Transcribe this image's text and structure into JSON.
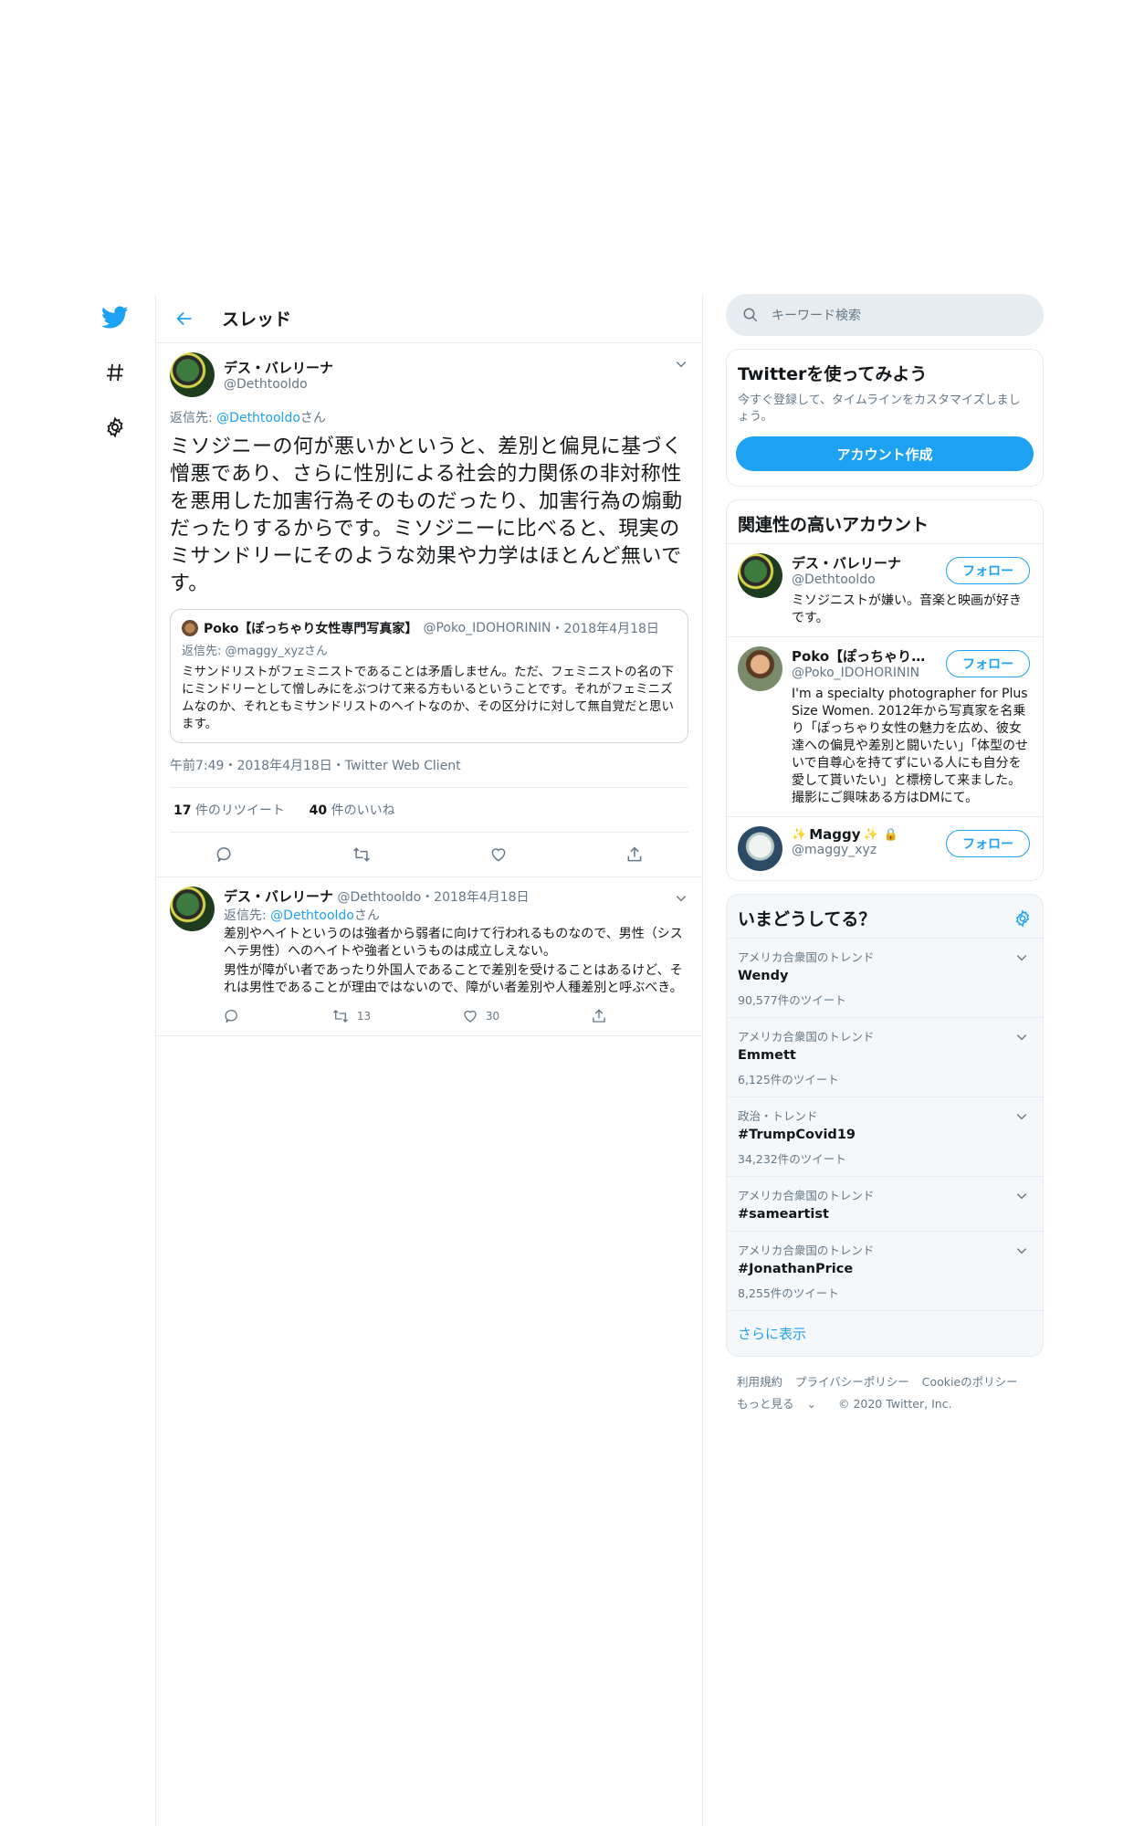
{
  "nav": {
    "icons": [
      "twitter-bird-icon",
      "hashtag-icon",
      "gear-icon"
    ]
  },
  "header": {
    "title": "スレッド"
  },
  "main_tweet": {
    "name": "デス・バレリーナ",
    "handle": "@Dethtooldo",
    "reply_prefix": "返信先: ",
    "reply_to": "@Dethtooldo",
    "reply_suffix": "さん",
    "text": "ミソジニーの何が悪いかというと、差別と偏見に基づく憎悪であり、さらに性別による社会的力関係の非対称性を悪用した加害行為そのものだったり、加害行為の煽動だったりするからです。ミソジニーに比べると、現実のミサンドリーにそのような効果や力学はほとんど無いです。",
    "quote": {
      "name": "Poko【ぽっちゃり女性専門写真家】",
      "handle": "@Poko_IDOHORININ",
      "date": "・2018年4月18日",
      "reply": "返信先: @maggy_xyzさん",
      "text": "ミサンドリストがフェミニストであることは矛盾しません。ただ、フェミニストの名の下にミンドリーとして憎しみにをぶつけて来る方もいるということです。それがフェミニズムなのか、それともミサンドリストのヘイトなのか、その区分けに対して無自覚だと思います。"
    },
    "meta": "午前7:49・2018年4月18日・Twitter Web Client",
    "retweets_count": "17",
    "retweets_label": " 件のリツイート",
    "likes_count": "40",
    "likes_label": " 件のいいね"
  },
  "reply_tweet": {
    "name": "デス・バレリーナ",
    "handle": "@Dethtooldo",
    "date": "・2018年4月18日",
    "reply_prefix": "返信先: ",
    "reply_to": "@Dethtooldo",
    "reply_suffix": "さん",
    "text1": "差別やヘイトというのは強者から弱者に向けて行われるものなので、男性（シスヘテ男性）へのヘイトや強者というものは成立しえない。",
    "text2": "男性が障がい者であったり外国人であることで差別を受けることはあるけど、それは男性であることが理由ではないので、障がい者差別や人種差別と呼ぶべき。",
    "retweets": "13",
    "likes": "30"
  },
  "search": {
    "placeholder": "キーワード検索"
  },
  "signup": {
    "title": "Twitterを使ってみよう",
    "subtitle": "今すぐ登録して、タイムラインをカスタマイズしましょう。",
    "button": "アカウント作成"
  },
  "related": {
    "title": "関連性の高いアカウント",
    "follow_label": "フォロー",
    "accounts": [
      {
        "name": "デス・バレリーナ",
        "handle": "@Dethtooldo",
        "bio": "ミソジニストが嫌い。音楽と映画が好きです。"
      },
      {
        "name": "Poko【ぽっちゃり女…",
        "handle": "@Poko_IDOHORININ",
        "bio": "I'm a specialty photographer for Plus Size Women. 2012年から写真家を名乗り「ぽっちゃり女性の魅力を広め、彼女達への偏見や差別と闘いたい」「体型のせいで自尊心を持てずにいる人にも自分を愛して貰いたい」と標榜して来ました。 撮影にご興味ある方はDMにて。"
      },
      {
        "name": "Maggy",
        "handle": "@maggy_xyz",
        "bio": ""
      }
    ]
  },
  "trends": {
    "title": "いまどうしてる？",
    "items": [
      {
        "category": "アメリカ合衆国のトレンド",
        "name": "Wendy",
        "count": "90,577件のツイート"
      },
      {
        "category": "アメリカ合衆国のトレンド",
        "name": "Emmett",
        "count": "6,125件のツイート"
      },
      {
        "category": "政治・トレンド",
        "name": "#TrumpCovid19",
        "count": "34,232件のツイート"
      },
      {
        "category": "アメリカ合衆国のトレンド",
        "name": "#sameartist",
        "count": ""
      },
      {
        "category": "アメリカ合衆国のトレンド",
        "name": "#JonathanPrice",
        "count": "8,255件のツイート"
      }
    ],
    "more": "さらに表示"
  },
  "footer": {
    "links": [
      "利用規約",
      "プライバシーポリシー",
      "Cookieのポリシー"
    ],
    "more": "もっと見る",
    "copyright": "© 2020 Twitter, Inc."
  },
  "colors": {
    "accent": "#1da1f2",
    "secondary_text": "#657786",
    "border": "#e6ecf0"
  }
}
